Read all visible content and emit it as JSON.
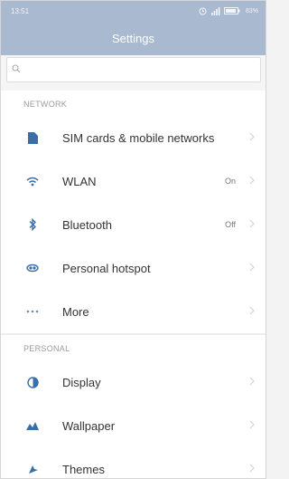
{
  "status_bar": {
    "time": "13:51",
    "battery_text": "83%"
  },
  "header": {
    "title": "Settings"
  },
  "search": {
    "placeholder": "",
    "value": ""
  },
  "sections": [
    {
      "title": "NETWORK",
      "items": [
        {
          "icon": "sim-card-icon",
          "label": "SIM cards & mobile networks",
          "value": ""
        },
        {
          "icon": "wifi-icon",
          "label": "WLAN",
          "value": "On"
        },
        {
          "icon": "bluetooth-icon",
          "label": "Bluetooth",
          "value": "Off"
        },
        {
          "icon": "hotspot-icon",
          "label": "Personal hotspot",
          "value": ""
        },
        {
          "icon": "more-icon",
          "label": "More",
          "value": ""
        }
      ]
    },
    {
      "title": "PERSONAL",
      "items": [
        {
          "icon": "display-icon",
          "label": "Display",
          "value": ""
        },
        {
          "icon": "wallpaper-icon",
          "label": "Wallpaper",
          "value": ""
        },
        {
          "icon": "themes-icon",
          "label": "Themes",
          "value": ""
        }
      ]
    }
  ],
  "colors": {
    "header": "#a9b9cf",
    "icon_accent": "#3a6ea8",
    "text": "#333333",
    "section_title": "#9a9a9a"
  }
}
